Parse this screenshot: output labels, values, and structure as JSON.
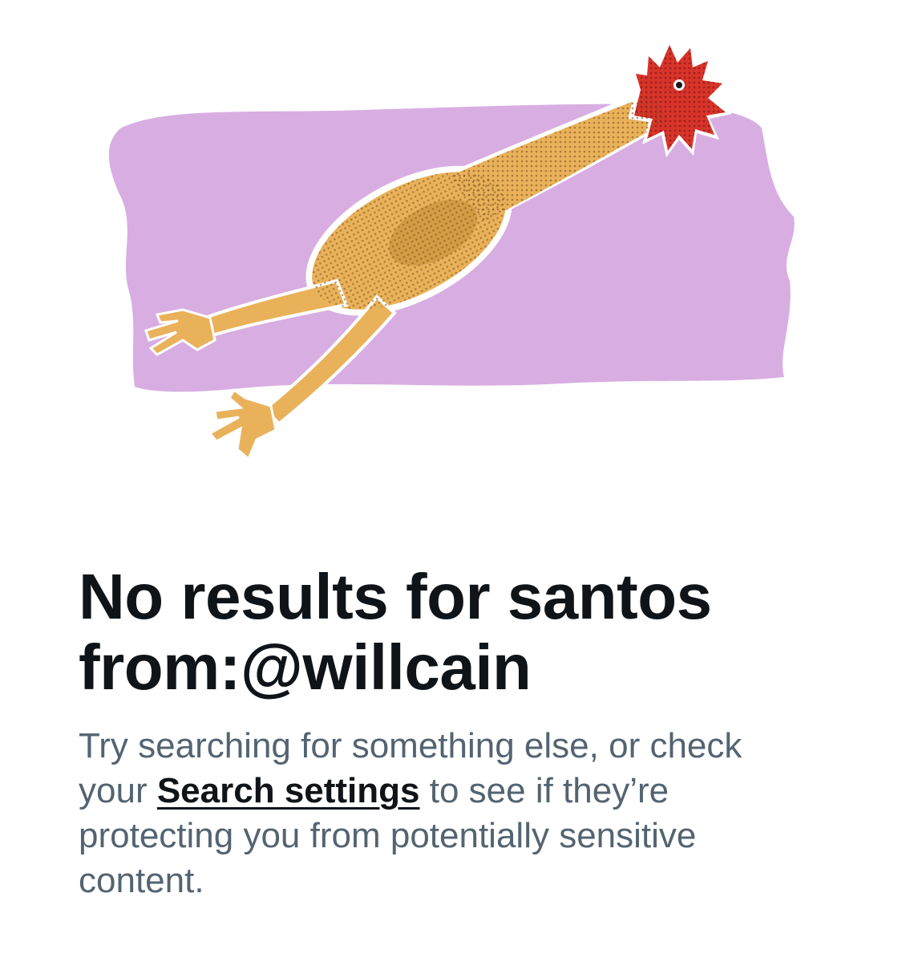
{
  "illustration": {
    "icon": "rubber-chicken-illustration",
    "background_color": "#d8aee2",
    "chicken_body_color": "#e9b25a",
    "chicken_head_color": "#d8342a"
  },
  "empty_state": {
    "title": "No results for santos from:@willcain",
    "description_before": "Try searching for something else, or check your ",
    "link_text": "Search settings",
    "description_after": " to see if they’re protecting you from potentially sensitive content.",
    "colors": {
      "title": "#0f1419",
      "description": "#536471"
    }
  }
}
